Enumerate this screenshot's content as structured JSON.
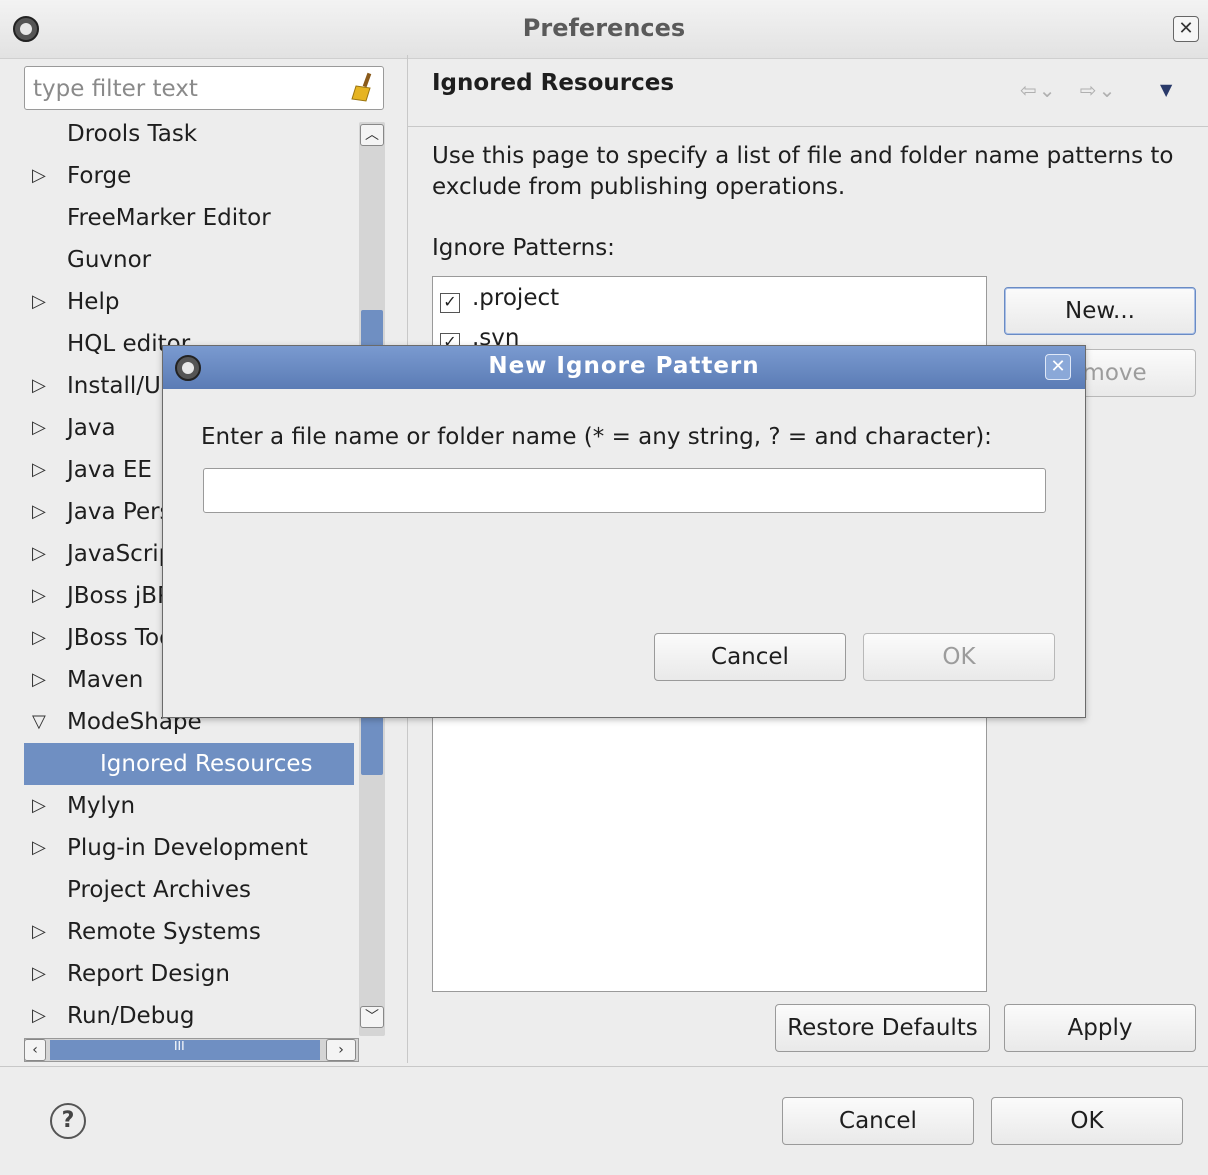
{
  "window": {
    "title": "Preferences"
  },
  "filter": {
    "placeholder": "type filter text"
  },
  "tree": {
    "items": [
      {
        "label": "Drools Task",
        "arrow": ""
      },
      {
        "label": "Forge",
        "arrow": "▷"
      },
      {
        "label": "FreeMarker Editor",
        "arrow": ""
      },
      {
        "label": "Guvnor",
        "arrow": ""
      },
      {
        "label": "Help",
        "arrow": "▷"
      },
      {
        "label": "HQL editor",
        "arrow": ""
      },
      {
        "label": "Install/Update",
        "arrow": "▷"
      },
      {
        "label": "Java",
        "arrow": "▷"
      },
      {
        "label": "Java EE",
        "arrow": "▷"
      },
      {
        "label": "Java Persistence",
        "arrow": "▷"
      },
      {
        "label": "JavaScript",
        "arrow": "▷"
      },
      {
        "label": "JBoss jBPM",
        "arrow": "▷"
      },
      {
        "label": "JBoss Tools",
        "arrow": "▷"
      },
      {
        "label": "Maven",
        "arrow": "▷"
      },
      {
        "label": "ModeShape",
        "arrow": "▽"
      },
      {
        "label": "Ignored Resources",
        "arrow": ""
      },
      {
        "label": "Mylyn",
        "arrow": "▷"
      },
      {
        "label": "Plug-in Development",
        "arrow": "▷"
      },
      {
        "label": "Project Archives",
        "arrow": ""
      },
      {
        "label": "Remote Systems",
        "arrow": "▷"
      },
      {
        "label": "Report Design",
        "arrow": "▷"
      },
      {
        "label": "Run/Debug",
        "arrow": "▷"
      }
    ],
    "hscroll_grip": "III"
  },
  "page": {
    "title": "Ignored Resources",
    "description": "Use this page to specify a list of file and folder name patterns to exclude from publishing operations.",
    "patterns_label": "Ignore Patterns:",
    "patterns": [
      {
        "name": ".project",
        "checked": true
      },
      {
        "name": ".svn",
        "checked": true
      }
    ],
    "new_button": "New...",
    "remove_button": "Remove",
    "restore_defaults_button": "Restore Defaults",
    "apply_button": "Apply"
  },
  "footer": {
    "cancel_button": "Cancel",
    "ok_button": "OK",
    "help_glyph": "?"
  },
  "dialog": {
    "title": "New Ignore Pattern",
    "prompt": "Enter a file name or folder name (* = any string, ? = and character):",
    "input_value": "",
    "cancel_button": "Cancel",
    "ok_button": "OK"
  },
  "icons": {
    "back": "⇦⌄",
    "forward": "⇨⌄",
    "menu": "▼",
    "close": "✕",
    "check": "✓"
  }
}
